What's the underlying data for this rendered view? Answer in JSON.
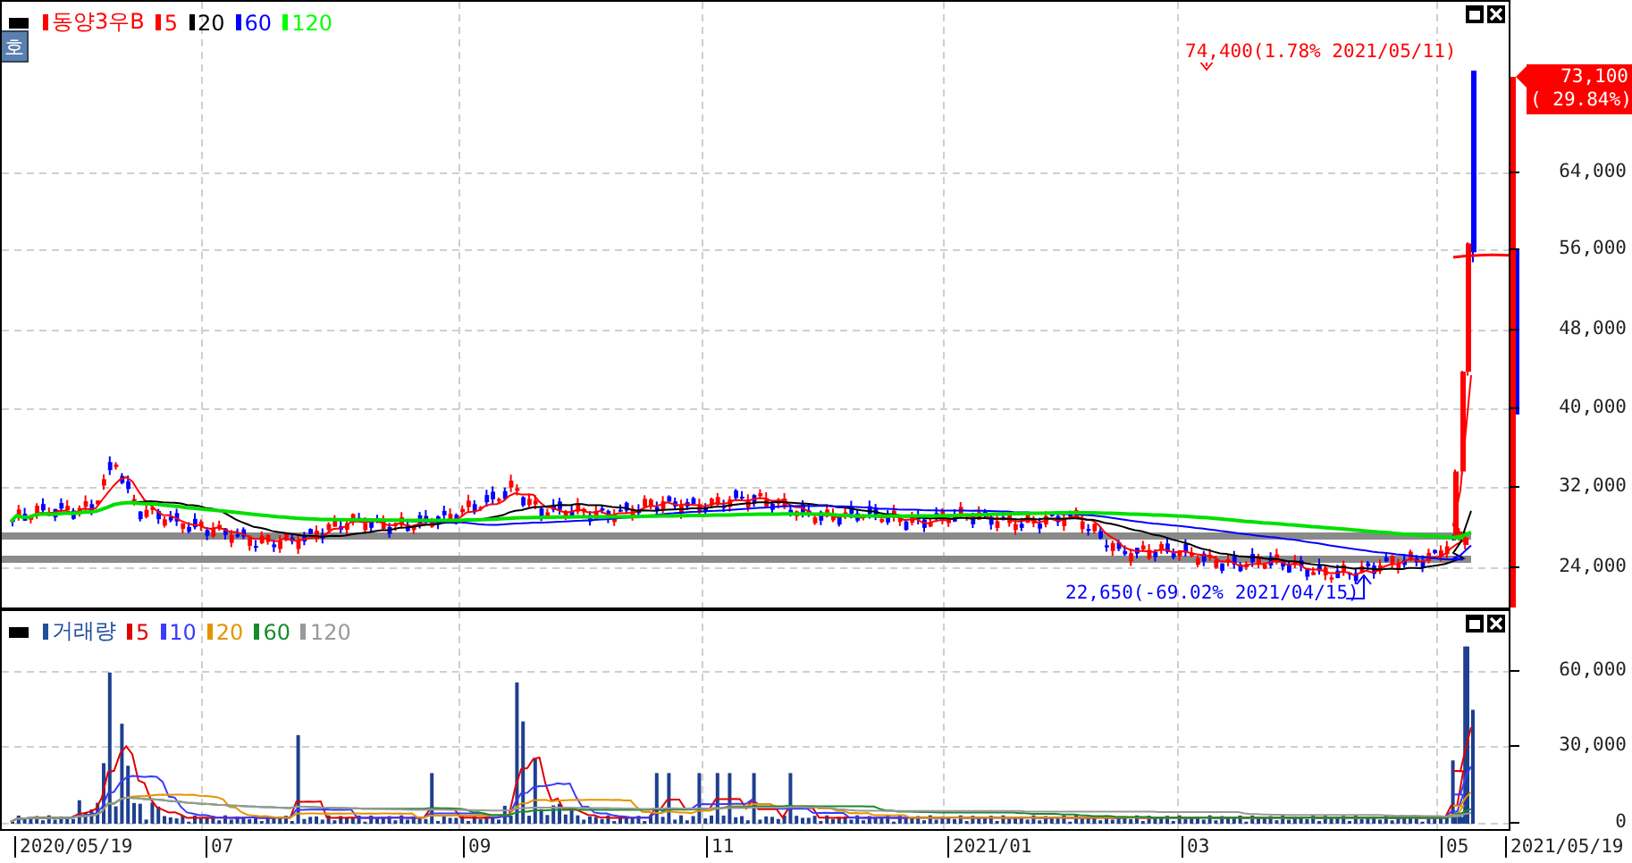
{
  "price_pane": {
    "badge": "호",
    "legend": {
      "title": "동양3우B",
      "ma": [
        {
          "label": "5",
          "color": "#ff0000"
        },
        {
          "label": "20",
          "color": "#000000"
        },
        {
          "label": "60",
          "color": "#0000ff"
        },
        {
          "label": "120",
          "color": "#00ff00"
        }
      ]
    },
    "high_label": "74,400(1.78% 2021/05/11)",
    "low_label": "22,650(-69.02% 2021/04/15)",
    "current_price": "73,100",
    "current_change": "( 29.84%)",
    "y_ticks": [
      "64,000",
      "56,000",
      "48,000",
      "40,000",
      "32,000",
      "24,000"
    ]
  },
  "volume_pane": {
    "legend": {
      "title": "거래량",
      "ma": [
        {
          "label": "5",
          "color": "#e00000"
        },
        {
          "label": "10",
          "color": "#3a3aff"
        },
        {
          "label": "20",
          "color": "#e59400"
        },
        {
          "label": "60",
          "color": "#1a8a2a"
        },
        {
          "label": "120",
          "color": "#999999"
        }
      ]
    },
    "y_ticks": [
      "60,000",
      "30,000",
      "0"
    ]
  },
  "x_axis": {
    "labels": [
      "2020/05/19",
      "07",
      "09",
      "11",
      "2021/01",
      "03",
      "05"
    ],
    "end_date": "2021/05/19"
  }
}
